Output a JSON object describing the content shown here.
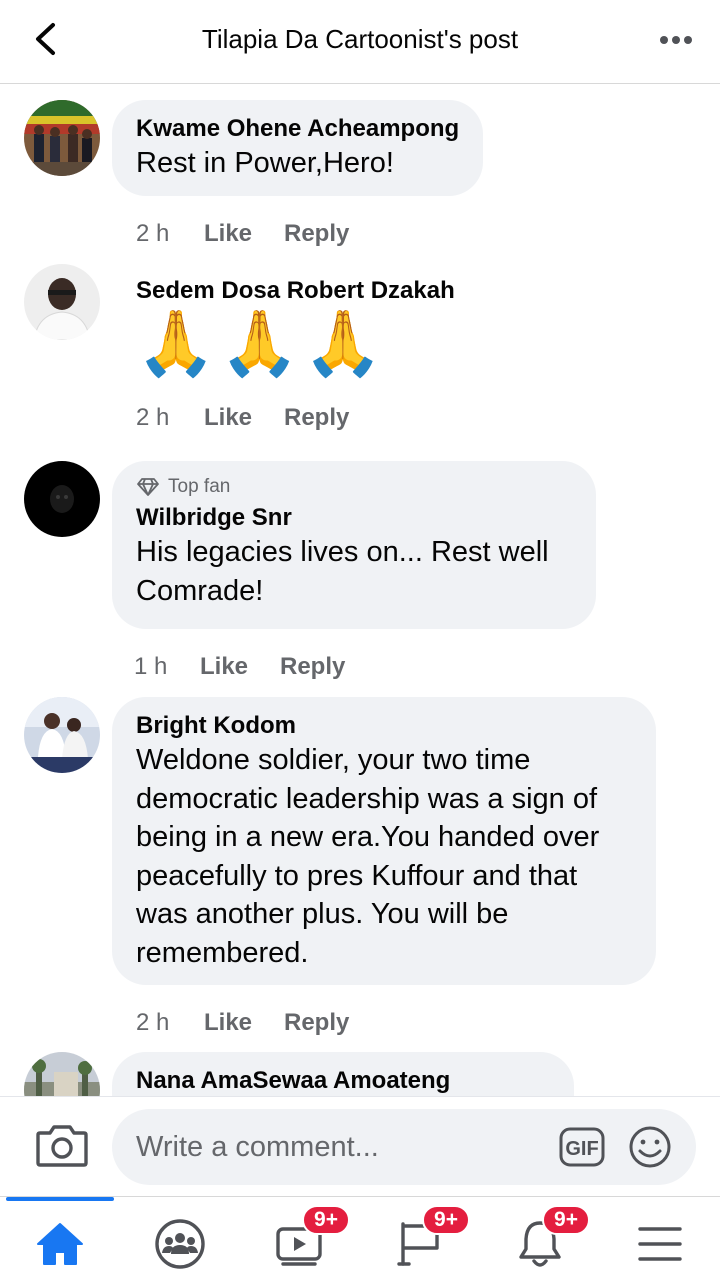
{
  "header": {
    "title": "Tilapia Da Cartoonist's post"
  },
  "comments": [
    {
      "author": "Kwame Ohene Acheampong",
      "text": "Rest in Power,Hero!",
      "time": "2 h",
      "like": "Like",
      "reply": "Reply"
    },
    {
      "author": "Sedem Dosa Robert Dzakah",
      "text": "🙏🙏🙏",
      "time": "2 h",
      "like": "Like",
      "reply": "Reply"
    },
    {
      "badge": "Top fan",
      "author": "Wilbridge Snr",
      "text_lines": [
        "His legacies lives on... Rest well",
        "Comrade!"
      ],
      "time": "1 h",
      "like": "Like",
      "reply": "Reply"
    },
    {
      "author": "Bright Kodom",
      "text_lines": [
        "Weldone soldier, your two time",
        "democratic leadership was a sign of",
        "being in a new era.You handed over",
        "peacefully to pres Kuffour and that",
        "was another plus. You will be",
        "remembered."
      ],
      "time": "2 h",
      "like": "Like",
      "reply": "Reply"
    },
    {
      "author": "Nana AmaSewaa Amoateng"
    }
  ],
  "composer": {
    "placeholder": "Write a comment...",
    "gif_label": "GIF"
  },
  "nav": {
    "watch_count": "9+",
    "groups_count": "9+",
    "notifications_count": "9+"
  },
  "colors": {
    "accent": "#1877f2",
    "badge": "#e41e3f",
    "bubble": "#f0f2f5",
    "secondary_text": "#65676b"
  }
}
